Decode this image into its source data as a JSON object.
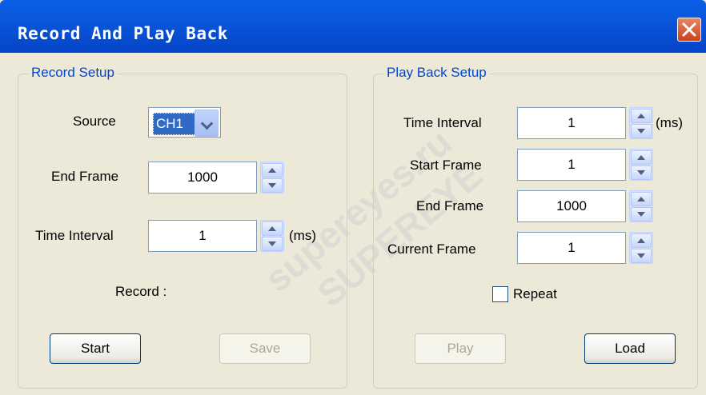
{
  "window": {
    "title": "Record And Play Back"
  },
  "record_setup": {
    "group_label": "Record Setup",
    "source_label": "Source",
    "source_value": "CH1",
    "end_frame_label": "End Frame",
    "end_frame_value": "1000",
    "time_interval_label": "Time Interval",
    "time_interval_value": "1",
    "time_interval_unit": "(ms)",
    "record_status_label": "Record :",
    "start_button": "Start",
    "save_button": "Save"
  },
  "playback_setup": {
    "group_label": "Play Back Setup",
    "time_interval_label": "Time Interval",
    "time_interval_value": "1",
    "time_interval_unit": "(ms)",
    "start_frame_label": "Start Frame",
    "start_frame_value": "1",
    "end_frame_label": "End Frame",
    "end_frame_value": "1000",
    "current_frame_label": "Current Frame",
    "current_frame_value": "1",
    "repeat_label": "Repeat",
    "repeat_checked": false,
    "play_button": "Play",
    "load_button": "Load"
  },
  "watermark": {
    "text1": "supereyes.ru",
    "text2": "SUPEREYE"
  }
}
